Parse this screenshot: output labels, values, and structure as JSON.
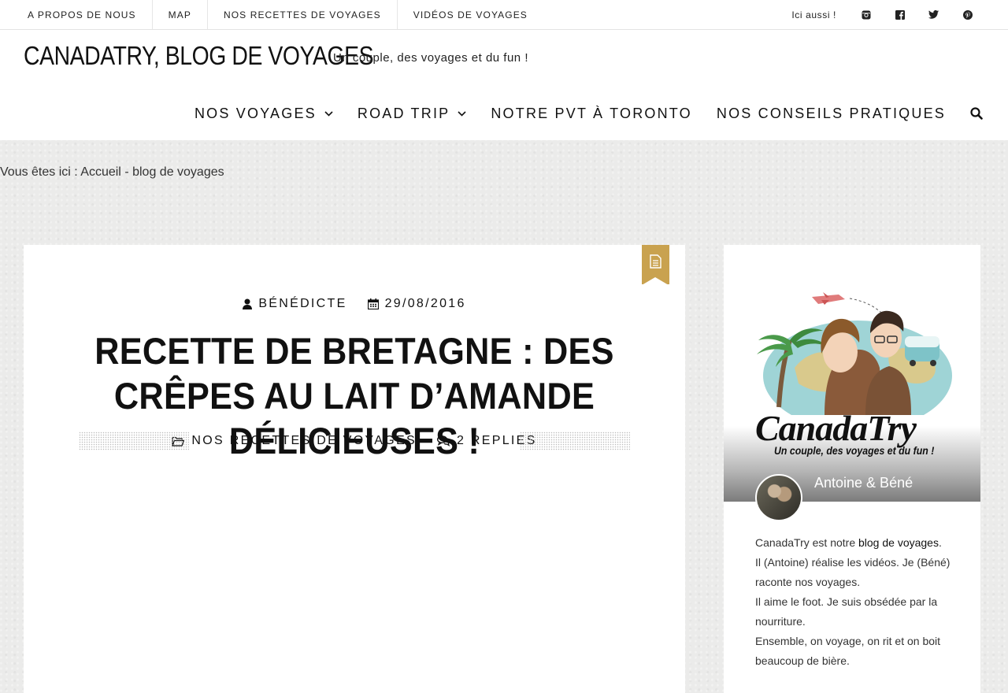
{
  "topbar": {
    "links": [
      "A propos de nous",
      "MAP",
      "Nos recettes de voyages",
      "Vidéos de voyages"
    ],
    "also_label": "Ici aussi !",
    "social": [
      "instagram-icon",
      "facebook-icon",
      "twitter-icon",
      "pinterest-icon"
    ]
  },
  "header": {
    "site_title": "CANADATRY, BLOG DE VOYAGES",
    "tagline": "Un couple, des voyages et du fun !",
    "nav": [
      {
        "label": "Nos voyages",
        "dropdown": true
      },
      {
        "label": "Road trip",
        "dropdown": true
      },
      {
        "label": "Notre PVT à Toronto",
        "dropdown": false
      },
      {
        "label": "Nos conseils pratiques",
        "dropdown": false
      }
    ]
  },
  "breadcrumb": {
    "prefix": "Vous êtes ici :",
    "home": "Accueil",
    "separator": "-",
    "current": "blog de voyages"
  },
  "post": {
    "author": "Bénédicte",
    "date": "29/08/2016",
    "title": "Recette de Bretagne : des crêpes au lait d’amande délicieuses !",
    "category": "Nos recettes de voyages",
    "replies": "2 replies"
  },
  "sidebar": {
    "brand_name": "CanadaTry",
    "brand_tagline": "Un couple, des voyages et du fun !",
    "authors": "Antoine & Béné",
    "bio_intro": "CanadaTry est notre",
    "bio_link": "blog de voyages",
    "bio_end": ".",
    "bio_lines": [
      "Il (Antoine) réalise les vidéos. Je (Béné) raconte nos voyages.",
      "Il aime le foot. Je suis obsédée par la nourriture.",
      "Ensemble, on voyage, on rit et on boit beaucoup de bière."
    ]
  },
  "colors": {
    "accent_gold": "#c9a24f",
    "text": "#111111",
    "background": "#ebebea"
  }
}
